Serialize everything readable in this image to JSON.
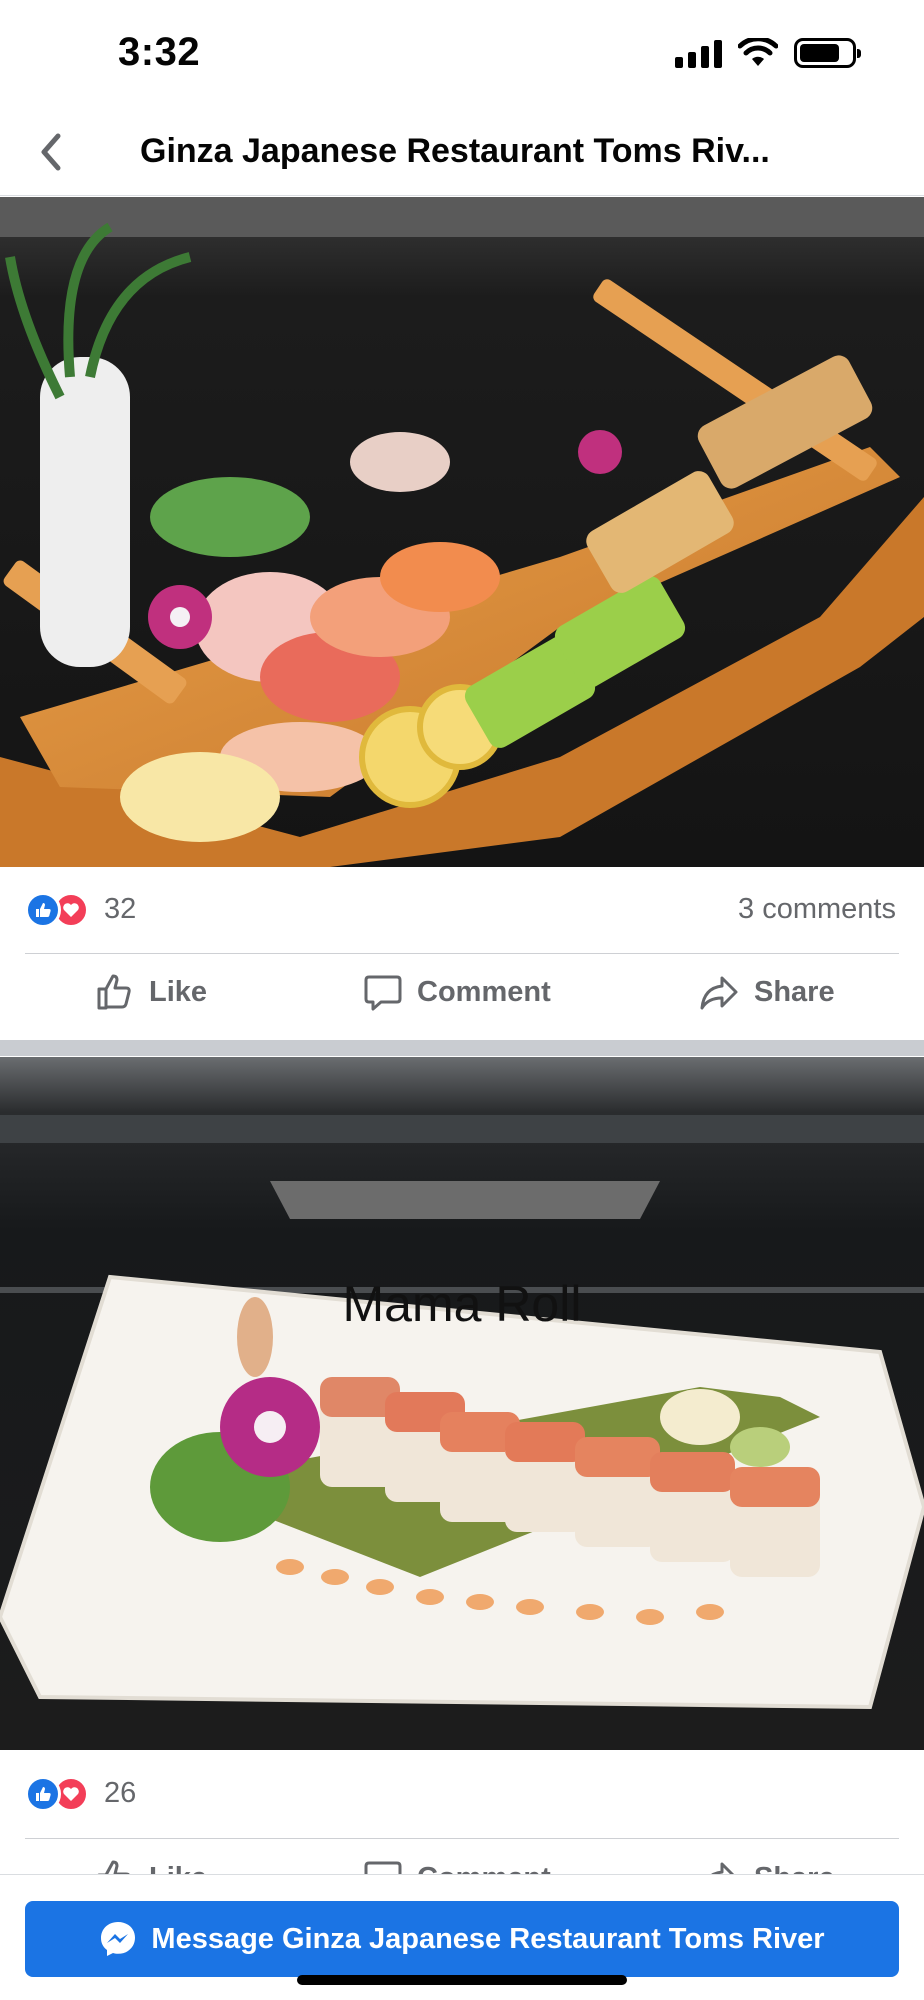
{
  "status_bar": {
    "time": "3:32"
  },
  "nav": {
    "title": "Ginza Japanese Restaurant Toms Riv..."
  },
  "posts": [
    {
      "photo_alt": "",
      "reaction_count": "32",
      "comments": "3 comments",
      "actions": {
        "like": "Like",
        "comment": "Comment",
        "share": "Share"
      }
    },
    {
      "photo_caption": "Mama Roll",
      "reaction_count": "26",
      "actions": {
        "like": "Like",
        "comment": "Comment",
        "share": "Share"
      }
    }
  ],
  "message_button": {
    "label": "Message Ginza Japanese Restaurant Toms River"
  },
  "colors": {
    "facebook_blue": "#1b74e4",
    "love_red": "#f33e58",
    "secondary_text": "#65676b",
    "separator": "#c9ccd1"
  },
  "icons": {
    "status": [
      "cellular-signal-icon",
      "wifi-icon",
      "battery-icon"
    ],
    "nav": [
      "back-chevron-icon"
    ],
    "reactions": [
      "like-reaction-icon",
      "love-reaction-icon"
    ],
    "actions": [
      "thumbs-up-icon",
      "comment-bubble-icon",
      "share-arrow-icon"
    ],
    "message": [
      "messenger-icon"
    ]
  }
}
